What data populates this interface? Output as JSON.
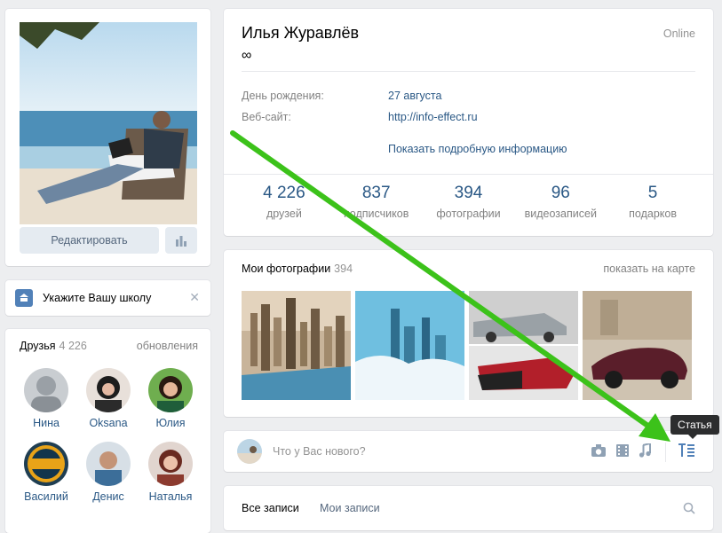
{
  "sidebar": {
    "edit_label": "Редактировать",
    "school_label": "Укажите Вашу школу",
    "friends": {
      "title": "Друзья",
      "count": "4 226",
      "updates_label": "обновления",
      "items": [
        {
          "name": "Нина"
        },
        {
          "name": "Oksana"
        },
        {
          "name": "Юлия"
        },
        {
          "name": "Василий"
        },
        {
          "name": "Денис"
        },
        {
          "name": "Наталья"
        }
      ]
    }
  },
  "profile": {
    "name": "Илья Журавлёв",
    "status": "∞",
    "online": "Online",
    "birthday_label": "День рождения:",
    "birthday_value": "27 августа",
    "website_label": "Веб-сайт:",
    "website_value": "http://info-effect.ru",
    "more_info": "Показать подробную информацию",
    "counters": [
      {
        "value": "4 226",
        "label": "друзей"
      },
      {
        "value": "837",
        "label": "подписчиков"
      },
      {
        "value": "394",
        "label": "фотографии"
      },
      {
        "value": "96",
        "label": "видеозаписей"
      },
      {
        "value": "5",
        "label": "подарков"
      }
    ]
  },
  "photos": {
    "title": "Мои фотографии",
    "count": "394",
    "map_label": "показать на карте"
  },
  "post": {
    "placeholder": "Что у Вас нового?",
    "tooltip": "Статья"
  },
  "wall": {
    "tab_all": "Все записи",
    "tab_mine": "Мои записи"
  },
  "colors": {
    "link": "#2a5885",
    "accent": "#5181b8",
    "arrow": "#3cc21a",
    "background": "#edeef0"
  }
}
